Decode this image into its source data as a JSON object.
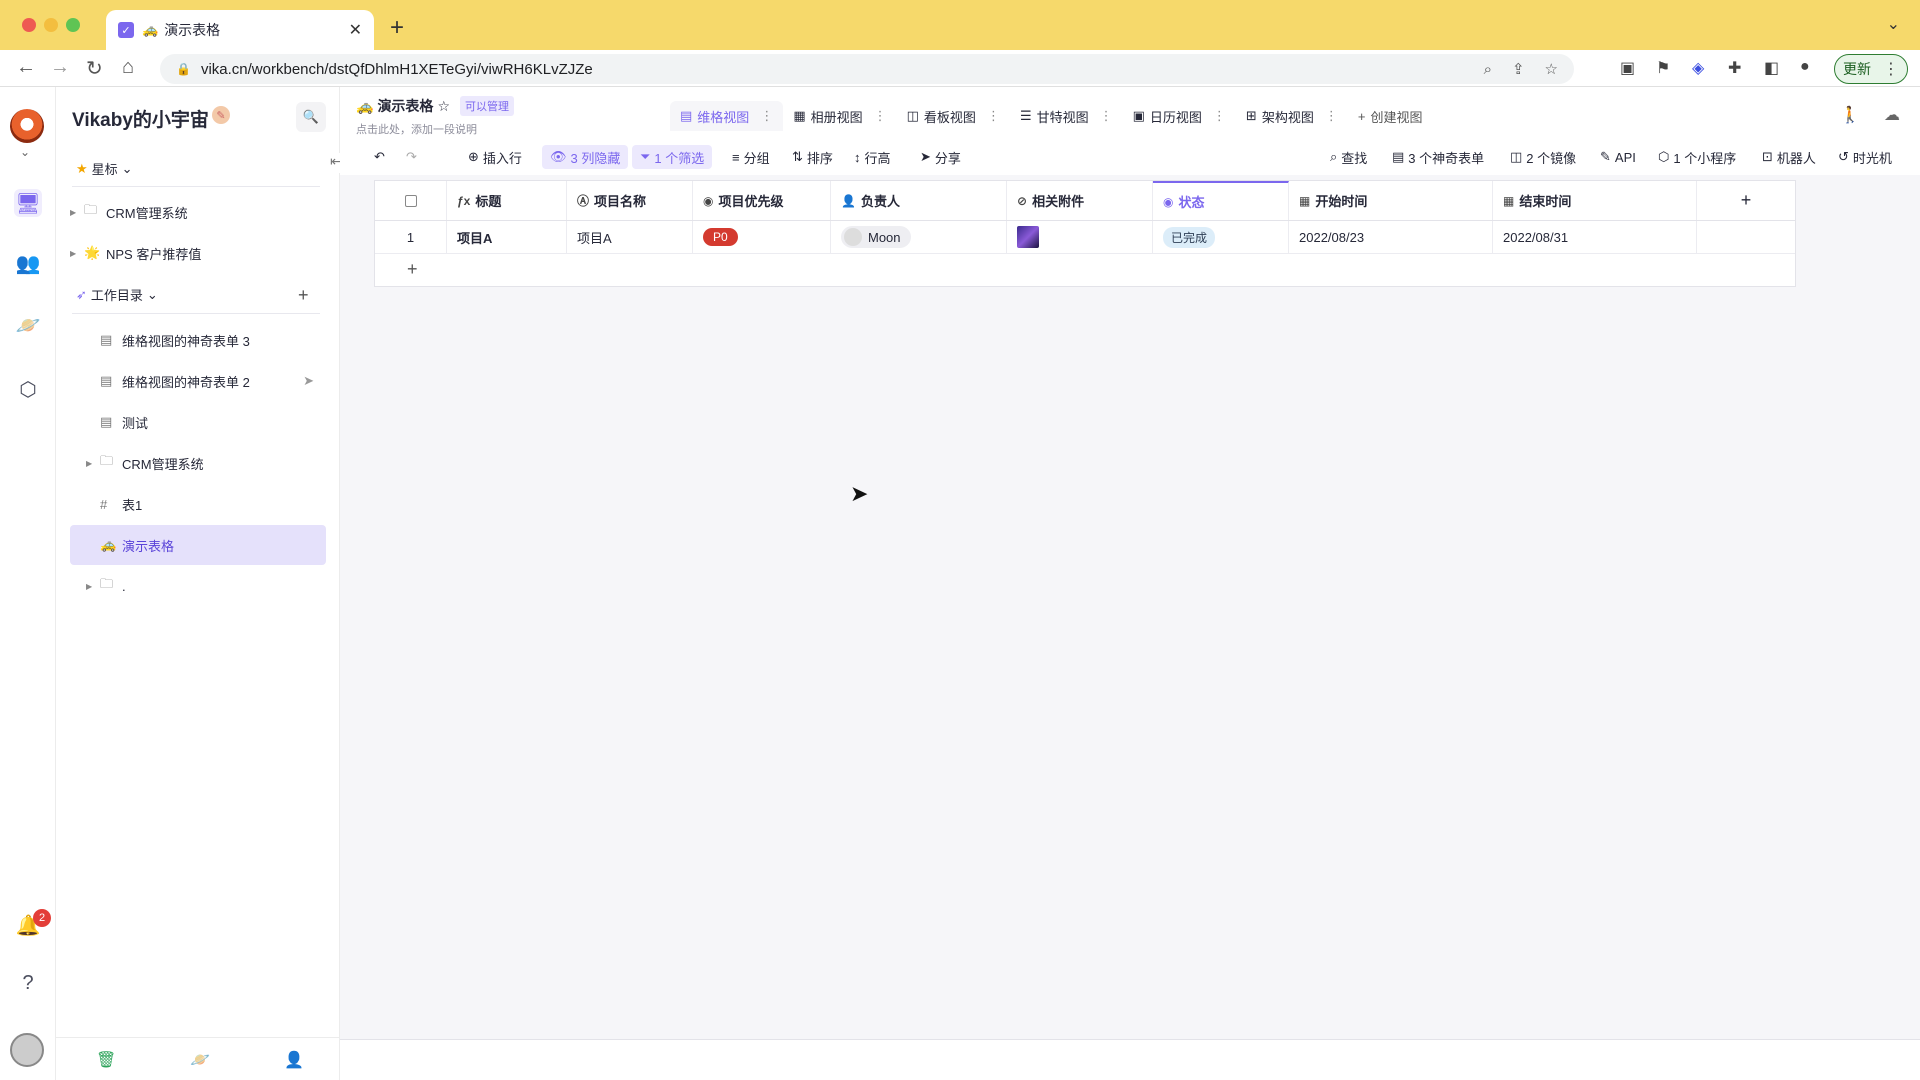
{
  "browser": {
    "tab_title": "演示表格",
    "tab_emoji": "🚕",
    "url": "vika.cn/workbench/dstQfDhlmH1XETeGyi/viwRH6KLvZJZe",
    "update_label": "更新"
  },
  "rail": {
    "notification_count": "2"
  },
  "sidebar": {
    "space_name": "Vikaby的小宇宙",
    "starred_label": "星标",
    "starred_items": [
      {
        "label": "CRM管理系统"
      },
      {
        "label": "NPS 客户推荐值"
      }
    ],
    "catalog_label": "工作目录",
    "catalog_items": [
      {
        "label": "维格视图的神奇表单 3"
      },
      {
        "label": "维格视图的神奇表单 2"
      },
      {
        "label": "测试"
      },
      {
        "label": "CRM管理系统"
      },
      {
        "label": "表1"
      },
      {
        "label": "演示表格"
      },
      {
        "label": "."
      }
    ]
  },
  "datasheet": {
    "title": "演示表格",
    "permission": "可以管理",
    "description": "点击此处，添加一段说明"
  },
  "views": [
    {
      "label": "维格视图"
    },
    {
      "label": "相册视图"
    },
    {
      "label": "看板视图"
    },
    {
      "label": "甘特视图"
    },
    {
      "label": "日历视图"
    },
    {
      "label": "架构视图"
    }
  ],
  "create_view": "创建视图",
  "toolbar": {
    "insert_row": "插入行",
    "hidden": "3 列隐藏",
    "filter": "1 个筛选",
    "group": "分组",
    "sort": "排序",
    "row_height": "行高",
    "share": "分享",
    "find": "查找",
    "forms": "3 个神奇表单",
    "mirrors": "2 个镜像",
    "api": "API",
    "widgets": "1 个小程序",
    "robot": "机器人",
    "timemachine": "时光机"
  },
  "table": {
    "columns": [
      {
        "label": "标题",
        "icon": "formula"
      },
      {
        "label": "项目名称",
        "icon": "text"
      },
      {
        "label": "项目优先级",
        "icon": "single-select"
      },
      {
        "label": "负责人",
        "icon": "member"
      },
      {
        "label": "相关附件",
        "icon": "attachment"
      },
      {
        "label": "状态",
        "icon": "single-select"
      },
      {
        "label": "开始时间",
        "icon": "date"
      },
      {
        "label": "结束时间",
        "icon": "date"
      }
    ],
    "rows": [
      {
        "index": "1",
        "title": "项目A",
        "name": "项目A",
        "priority": "P0",
        "owner": "Moon",
        "status": "已完成",
        "start": "2022/08/23",
        "end": "2022/08/31"
      }
    ]
  }
}
